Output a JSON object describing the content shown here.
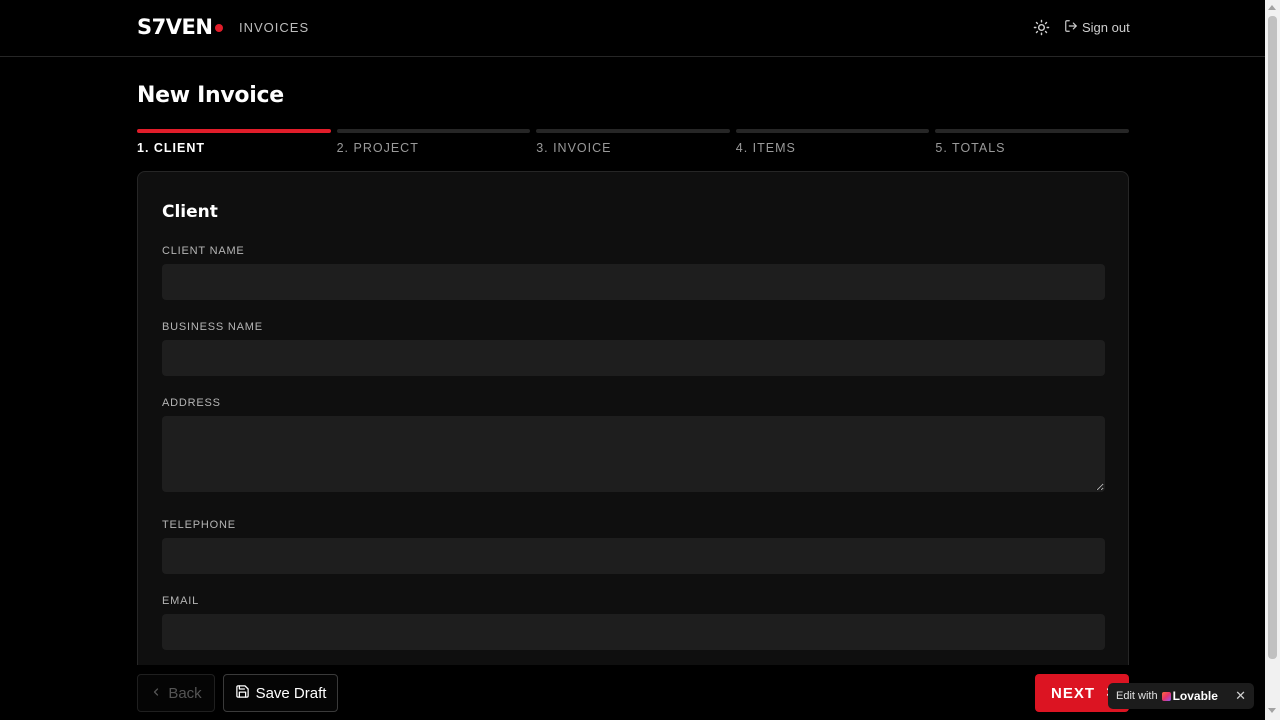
{
  "header": {
    "logo": "S7VEN",
    "nav_invoices": "INVOICES",
    "theme_icon": "sun-icon",
    "signout_label": "Sign out",
    "signout_icon": "log-out-icon",
    "accent_color": "#e11d2a"
  },
  "page": {
    "title": "New Invoice"
  },
  "steps": [
    {
      "label": "1. CLIENT",
      "active": true
    },
    {
      "label": "2. PROJECT",
      "active": false
    },
    {
      "label": "3. INVOICE",
      "active": false
    },
    {
      "label": "4. ITEMS",
      "active": false
    },
    {
      "label": "5. TOTALS",
      "active": false
    }
  ],
  "client_section": {
    "title": "Client",
    "fields": {
      "client_name": {
        "label": "CLIENT NAME",
        "value": "",
        "placeholder": ""
      },
      "business_name": {
        "label": "BUSINESS NAME",
        "value": "",
        "placeholder": ""
      },
      "address": {
        "label": "ADDRESS",
        "value": "",
        "placeholder": ""
      },
      "telephone": {
        "label": "TELEPHONE",
        "value": "",
        "placeholder": ""
      },
      "email": {
        "label": "EMAIL",
        "value": "",
        "placeholder": ""
      }
    }
  },
  "footer": {
    "back_label": "Back",
    "save_draft_label": "Save Draft",
    "next_label": "NEXT"
  },
  "lovable_badge": {
    "prefix": "Edit with",
    "brand": "Lovable",
    "close": "✕"
  }
}
